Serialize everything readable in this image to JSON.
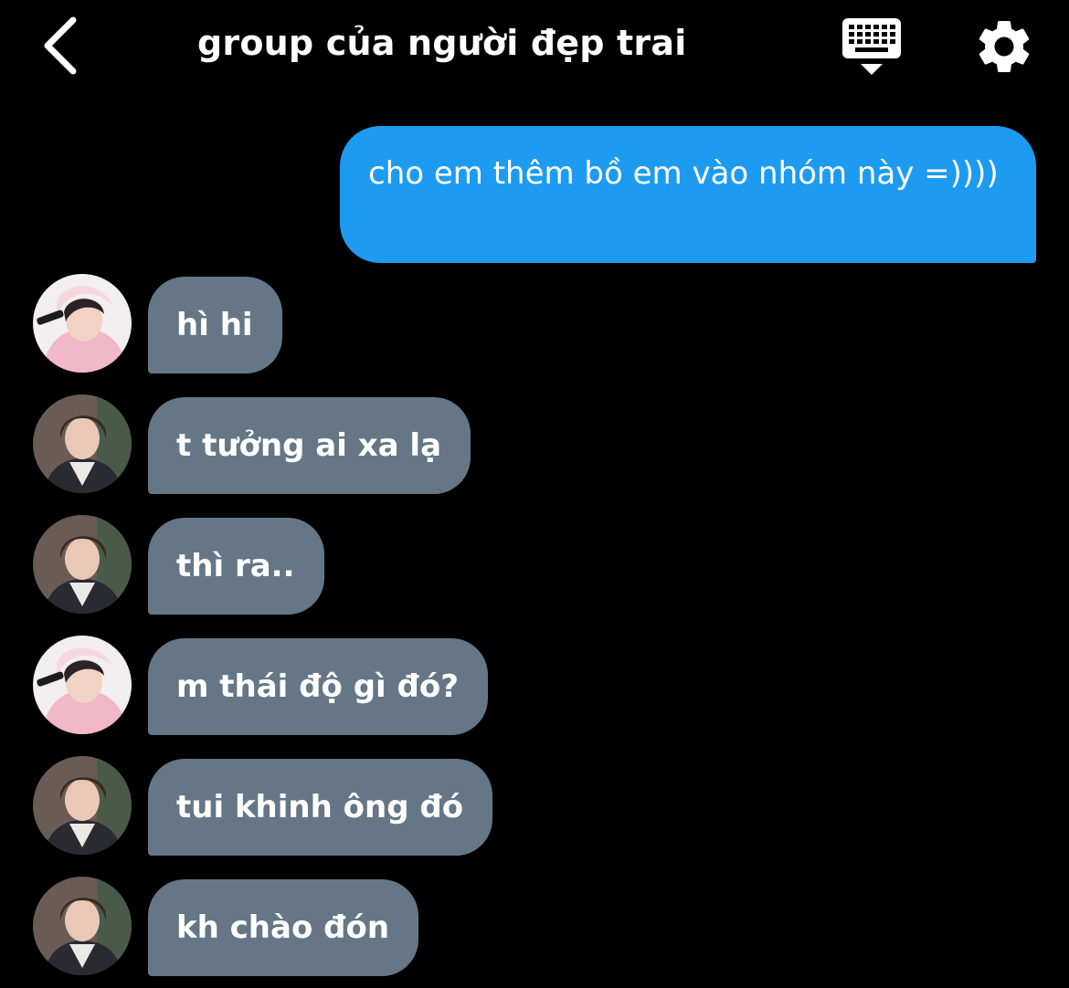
{
  "header": {
    "title": "group của người đẹp trai",
    "back_icon": "chevron-left-icon",
    "keyboard_icon": "keyboard-icon",
    "settings_icon": "gear-icon"
  },
  "colors": {
    "background": "#000000",
    "outgoing_bubble": "#1d9bf0",
    "incoming_bubble": "#657786",
    "text": "#ffffff"
  },
  "messages": {
    "outgoing": [
      {
        "text": "cho em thêm bồ em vào nhóm này =))))"
      }
    ],
    "incoming": [
      {
        "text": "hì hi",
        "avatar": "avatar-pink-hoodie"
      },
      {
        "text": "t tưởng ai xa lạ",
        "avatar": "avatar-curly-hair"
      },
      {
        "text": "thì ra..",
        "avatar": "avatar-curly-hair"
      },
      {
        "text": "m thái độ gì đó?",
        "avatar": "avatar-pink-hoodie"
      },
      {
        "text": "tui khinh ông đó",
        "avatar": "avatar-curly-hair"
      },
      {
        "text": "kh chào đón",
        "avatar": "avatar-curly-hair"
      }
    ]
  }
}
